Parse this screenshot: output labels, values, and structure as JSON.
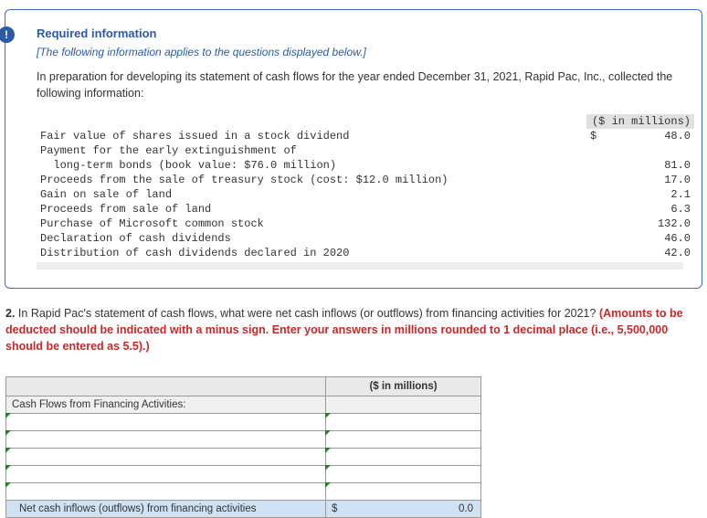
{
  "alert_glyph": "!",
  "required_info_title": "Required information",
  "applies_note": "[The following information applies to the questions displayed below.]",
  "prep_text": "In preparation for developing its statement of cash flows for the year ended December 31, 2021, Rapid Pac, Inc., collected the following information:",
  "data_header": "($ in millions)",
  "data_rows": [
    {
      "label": "Fair value of shares issued in a stock dividend",
      "dollar": "$",
      "value": "48.0"
    },
    {
      "label": "Payment for the early extinguishment of",
      "dollar": "",
      "value": ""
    },
    {
      "label": "  long-term bonds (book value: $76.0 million)",
      "dollar": "",
      "value": "81.0"
    },
    {
      "label": "Proceeds from the sale of treasury stock (cost: $12.0 million)",
      "dollar": "",
      "value": "17.0"
    },
    {
      "label": "Gain on sale of land",
      "dollar": "",
      "value": "2.1"
    },
    {
      "label": "Proceeds from sale of land",
      "dollar": "",
      "value": "6.3"
    },
    {
      "label": "Purchase of Microsoft common stock",
      "dollar": "",
      "value": "132.0"
    },
    {
      "label": "Declaration of cash dividends",
      "dollar": "",
      "value": "46.0"
    },
    {
      "label": "Distribution of cash dividends declared in 2020",
      "dollar": "",
      "value": "42.0"
    }
  ],
  "question": {
    "number": "2.",
    "text": "In Rapid Pac's statement of cash flows, what were net cash inflows (or outflows) from financing activities for 2021? ",
    "instruction": "(Amounts to be deducted should be indicated with a minus sign. Enter your answers in millions rounded to 1 decimal place (i.e., 5,500,000 should be entered as 5.5).)"
  },
  "answer_table": {
    "col_header": "($ in millions)",
    "section_label": "Cash Flows from Financing Activities:",
    "blank_rows": 5,
    "total_label": "Net cash inflows (outflows) from financing activities",
    "total_dollar": "$",
    "total_value": "0.0"
  }
}
